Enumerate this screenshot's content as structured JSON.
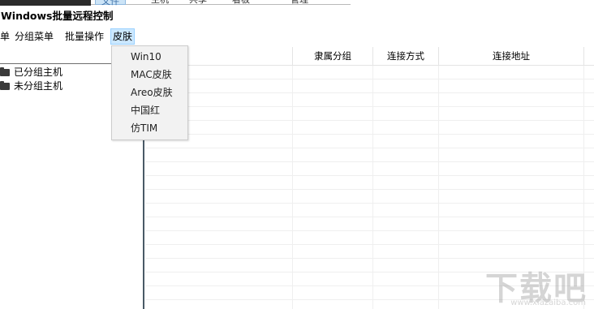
{
  "top_tabs": [
    {
      "label": "文件"
    },
    {
      "label": "主机"
    },
    {
      "label": "共享"
    },
    {
      "label": "看板"
    },
    {
      "label": "管理"
    }
  ],
  "window": {
    "title": "Windows批量远程控制"
  },
  "menubar": {
    "items": [
      {
        "label": "单"
      },
      {
        "label": "分组菜单"
      },
      {
        "label": "批量操作"
      },
      {
        "label": "皮肤"
      }
    ]
  },
  "tree": {
    "nodes": [
      {
        "label": "已分组主机",
        "icon": "folder-icon"
      },
      {
        "label": "未分组主机",
        "icon": "folder-icon"
      }
    ]
  },
  "grid": {
    "columns": [
      {
        "label": ""
      },
      {
        "label": "隶属分组"
      },
      {
        "label": "连接方式"
      },
      {
        "label": "连接地址"
      }
    ]
  },
  "skin_menu": {
    "items": [
      {
        "label": "Win10"
      },
      {
        "label": "MAC皮肤"
      },
      {
        "label": "Areo皮肤"
      },
      {
        "label": "中国红"
      },
      {
        "label": "仿TIM"
      }
    ]
  },
  "watermark": {
    "big": "下载吧",
    "small": "www.xiazaiba.com"
  },
  "colors": {
    "menu_active_bg": "#cce8ff",
    "dropdown_bg": "#f2f2f2",
    "splitter": "#4a5a66"
  }
}
